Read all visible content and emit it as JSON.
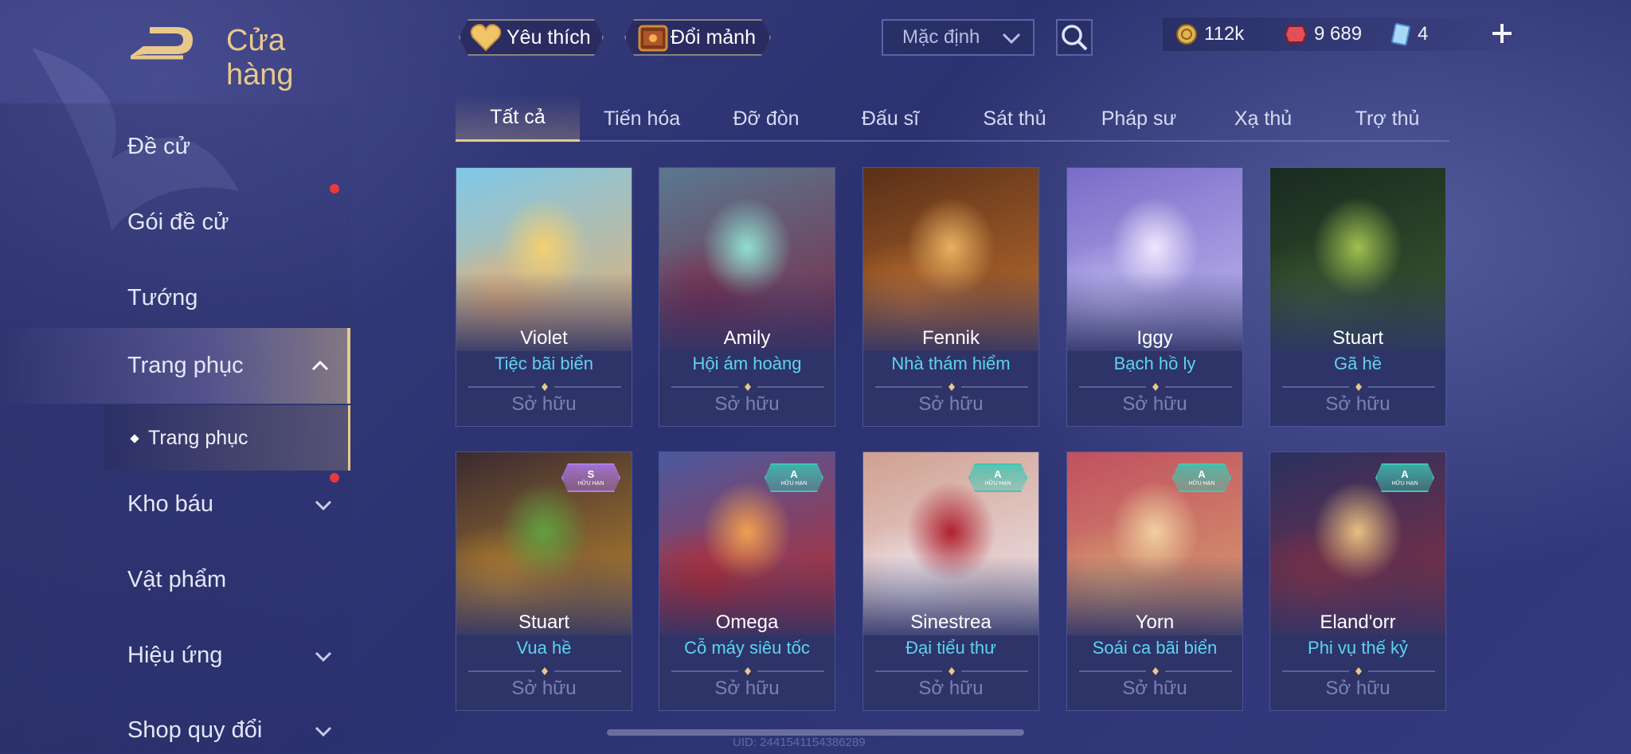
{
  "header": {
    "title": "Cửa hàng",
    "favorites_label": "Yêu thích",
    "exchange_label": "Đổi mảnh",
    "sort_value": "Mặc định"
  },
  "currency": {
    "gold": "112k",
    "vouchers": "9 689",
    "tickets": "4"
  },
  "sidebar": {
    "items": [
      {
        "label": "Đề cử"
      },
      {
        "label": "Gói đề cử"
      },
      {
        "label": "Tướng"
      },
      {
        "label": "Trang phục"
      },
      {
        "label": "Kho báu"
      },
      {
        "label": "Vật phẩm"
      },
      {
        "label": "Hiệu ứng"
      },
      {
        "label": "Shop quy đổi"
      }
    ],
    "sub_item": "Trang phục"
  },
  "tabs": [
    "Tất cả",
    "Tiến hóa",
    "Đỡ đòn",
    "Đấu sĩ",
    "Sát thủ",
    "Pháp sư",
    "Xạ thủ",
    "Trợ thủ"
  ],
  "cards": [
    {
      "hero": "Violet",
      "skin": "Tiệc bãi biển",
      "status": "Sở hữu"
    },
    {
      "hero": "Amily",
      "skin": "Hội ám hoàng",
      "status": "Sở hữu"
    },
    {
      "hero": "Fennik",
      "skin": "Nhà thám hiểm",
      "status": "Sở hữu"
    },
    {
      "hero": "Iggy",
      "skin": "Bạch hồ ly",
      "status": "Sở hữu"
    },
    {
      "hero": "Stuart",
      "skin": "Gã hề",
      "status": "Sở hữu"
    },
    {
      "hero": "Stuart",
      "skin": "Vua hề",
      "status": "Sở hữu",
      "badge": {
        "tier": "S",
        "label": "HỮU HẠN",
        "color": "#b27cf0"
      }
    },
    {
      "hero": "Omega",
      "skin": "Cỗ máy siêu tốc",
      "status": "Sở hữu",
      "badge": {
        "tier": "A",
        "label": "HỮU HẠN",
        "color": "#3cc8b4"
      }
    },
    {
      "hero": "Sinestrea",
      "skin": "Đại tiểu thư",
      "status": "Sở hữu",
      "badge": {
        "tier": "A",
        "label": "HỮU HẠN",
        "color": "#3cc8b4"
      }
    },
    {
      "hero": "Yorn",
      "skin": "Soái ca bãi biển",
      "status": "Sở hữu",
      "badge": {
        "tier": "A",
        "label": "HỮU HẠN",
        "color": "#3cc8b4"
      }
    },
    {
      "hero": "Eland'orr",
      "skin": "Phi vụ thế kỷ",
      "status": "Sở hữu",
      "badge": {
        "tier": "A",
        "label": "HỮU HẠN",
        "color": "#3cc8b4"
      }
    }
  ],
  "footer": {
    "uid": "UID: 2441541154386289"
  },
  "colors": {
    "accent": "#e8c98a",
    "skin_name": "#5fd2f2",
    "notification": "#e83a3a"
  }
}
